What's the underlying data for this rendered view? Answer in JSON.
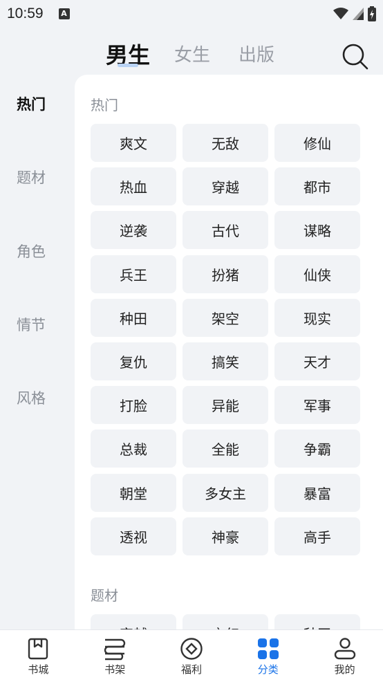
{
  "status_bar": {
    "time": "10:59",
    "notif_letter": "A"
  },
  "top_tabs": [
    {
      "label": "男生",
      "active": true
    },
    {
      "label": "女生",
      "active": false
    },
    {
      "label": "出版",
      "active": false
    }
  ],
  "sidebar": {
    "items": [
      {
        "label": "热门",
        "active": true
      },
      {
        "label": "题材",
        "active": false
      },
      {
        "label": "角色",
        "active": false
      },
      {
        "label": "情节",
        "active": false
      },
      {
        "label": "风格",
        "active": false
      }
    ]
  },
  "sections": [
    {
      "title": "热门",
      "tags": [
        "爽文",
        "无敌",
        "修仙",
        "热血",
        "穿越",
        "都市",
        "逆袭",
        "古代",
        "谋略",
        "兵王",
        "扮猪",
        "仙侠",
        "种田",
        "架空",
        "现实",
        "复仇",
        "搞笑",
        "天才",
        "打脸",
        "异能",
        "军事",
        "总裁",
        "全能",
        "争霸",
        "朝堂",
        "多女主",
        "暴富",
        "透视",
        "神豪",
        "高手"
      ]
    },
    {
      "title": "题材",
      "tags": [
        "穿越",
        "玄幻",
        "种田"
      ]
    }
  ],
  "bottom_nav": [
    {
      "label": "书城",
      "icon": "bookmark-book-icon",
      "active": false
    },
    {
      "label": "书架",
      "icon": "bookshelf-icon",
      "active": false
    },
    {
      "label": "福利",
      "icon": "gift-diamond-icon",
      "active": false
    },
    {
      "label": "分类",
      "icon": "category-grid-icon",
      "active": true
    },
    {
      "label": "我的",
      "icon": "profile-icon",
      "active": false
    }
  ],
  "colors": {
    "accent": "#1a73e8",
    "background": "#f1f3f6",
    "tag_bg": "#f1f3f6"
  }
}
